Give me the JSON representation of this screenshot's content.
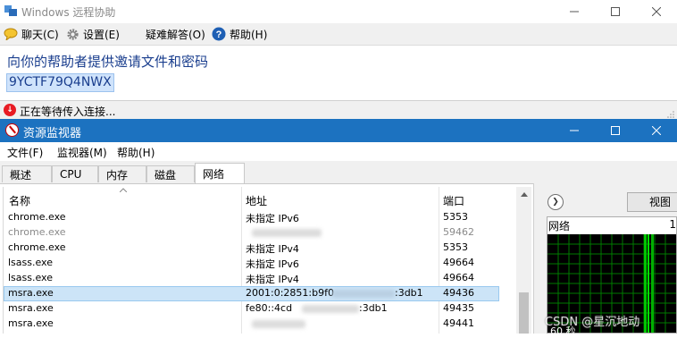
{
  "remote_assistance": {
    "title": "Windows 远程协助",
    "menu": {
      "chat": "聊天(C)",
      "settings": "设置(E)",
      "troubleshoot": "疑难解答(O)",
      "help": "帮助(H)"
    },
    "instruction": "向你的帮助者提供邀请文件和密码",
    "password": "9YCTF79Q4NWX",
    "status": "正在等待传入连接..."
  },
  "resource_monitor": {
    "title": "资源监视器",
    "menu": {
      "file": "文件(F)",
      "monitor": "监视器(M)",
      "help": "帮助(H)"
    },
    "tabs": [
      "概述",
      "CPU",
      "内存",
      "磁盘",
      "网络"
    ],
    "active_tab": "网络",
    "columns": {
      "name": "名称",
      "address": "地址",
      "port": "端口"
    },
    "rows": [
      {
        "name": "chrome.exe",
        "address": "未指定 IPv6",
        "port": "5353"
      },
      {
        "name": "chrome.exe",
        "address": "",
        "port": "59462"
      },
      {
        "name": "chrome.exe",
        "address": "未指定 IPv4",
        "port": "5353"
      },
      {
        "name": "lsass.exe",
        "address": "未指定 IPv6",
        "port": "49664"
      },
      {
        "name": "lsass.exe",
        "address": "未指定 IPv4",
        "port": "49664"
      },
      {
        "name": "msra.exe",
        "address_prefix": "2001:0:2851:b9f0",
        "address_suffix": ":3db1",
        "port": "49436"
      },
      {
        "name": "msra.exe",
        "address_prefix": "fe80::4cd",
        "address_suffix": ":3db1",
        "port": "49435"
      },
      {
        "name": "msra.exe",
        "address": "",
        "port": "49441"
      }
    ],
    "right_panel": {
      "view_button": "视图",
      "graph_label": "网络",
      "graph_value": "1",
      "graph_footer": "60 秒"
    }
  },
  "watermark": "CSDN @星沉地动",
  "colors": {
    "rm_title": "#1c72c0",
    "selection": "#cce4f7",
    "graph_line": "#00c000",
    "link_text": "#1a3e8e"
  }
}
